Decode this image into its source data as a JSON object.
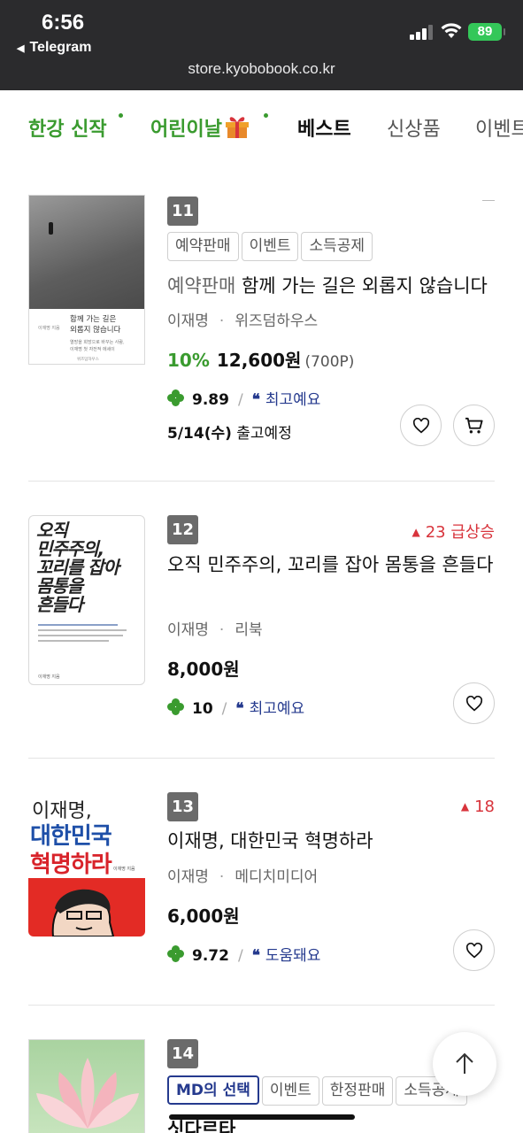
{
  "status_bar": {
    "time": "6:56",
    "back_label": "Telegram",
    "battery": "89"
  },
  "browser": {
    "url": "store.kyobobook.co.kr"
  },
  "tabs": [
    {
      "label": "한강 신작",
      "dot": true
    },
    {
      "label": "어린이날",
      "dot": true
    },
    {
      "label": "베스트",
      "active": true
    },
    {
      "label": "신상품"
    },
    {
      "label": "이벤트"
    }
  ],
  "books": [
    {
      "rank": "11",
      "tags": [
        "예약판매",
        "이벤트",
        "소득공제"
      ],
      "title_prefix": "예약판매",
      "title": "함께 가는 길은 외롭지 않습니다",
      "author": "이재명",
      "publisher": "위즈덤하우스",
      "discount": "10%",
      "price": "12,600원",
      "points": "(700P)",
      "rating": "9.89",
      "review_tag": "최고예요",
      "shipping_date": "5/14(수)",
      "shipping_label": "출고예정",
      "cover": {
        "title_line1": "함께 가는 길은",
        "title_line2": "외롭지 않습니다",
        "author": "이재명 지음",
        "blurb": "열망을 희망으로 바꾸는 사람,",
        "blurb2": "이재명 첫 자전적 에세이",
        "publisher": "위즈덤하우스"
      }
    },
    {
      "rank": "12",
      "trend": "23 급상승",
      "title": "오직 민주주의, 꼬리를 잡아 몸통을 흔들다",
      "author": "이재명",
      "publisher": "리북",
      "price": "8,000원",
      "rating": "10",
      "review_tag": "최고예요",
      "cover": {
        "line1": "오직",
        "line2": "민주주의,",
        "line3": "꼬리를 잡아",
        "line4": "몸통을",
        "line5": "흔들다",
        "author": "이재명 지음"
      }
    },
    {
      "rank": "13",
      "trend": "18",
      "title": "이재명, 대한민국 혁명하라",
      "author": "이재명",
      "publisher": "메디치미디어",
      "price": "6,000원",
      "rating": "9.72",
      "review_tag": "도움돼요",
      "cover": {
        "line1": "이재명,",
        "line2": "대한민국",
        "line3": "혁명하라",
        "author": "이재명 지음"
      }
    },
    {
      "rank": "14",
      "tags": [
        "MD의 선택",
        "이벤트",
        "한정판매",
        "소득공제"
      ],
      "title_partial": "싯다르타"
    }
  ]
}
